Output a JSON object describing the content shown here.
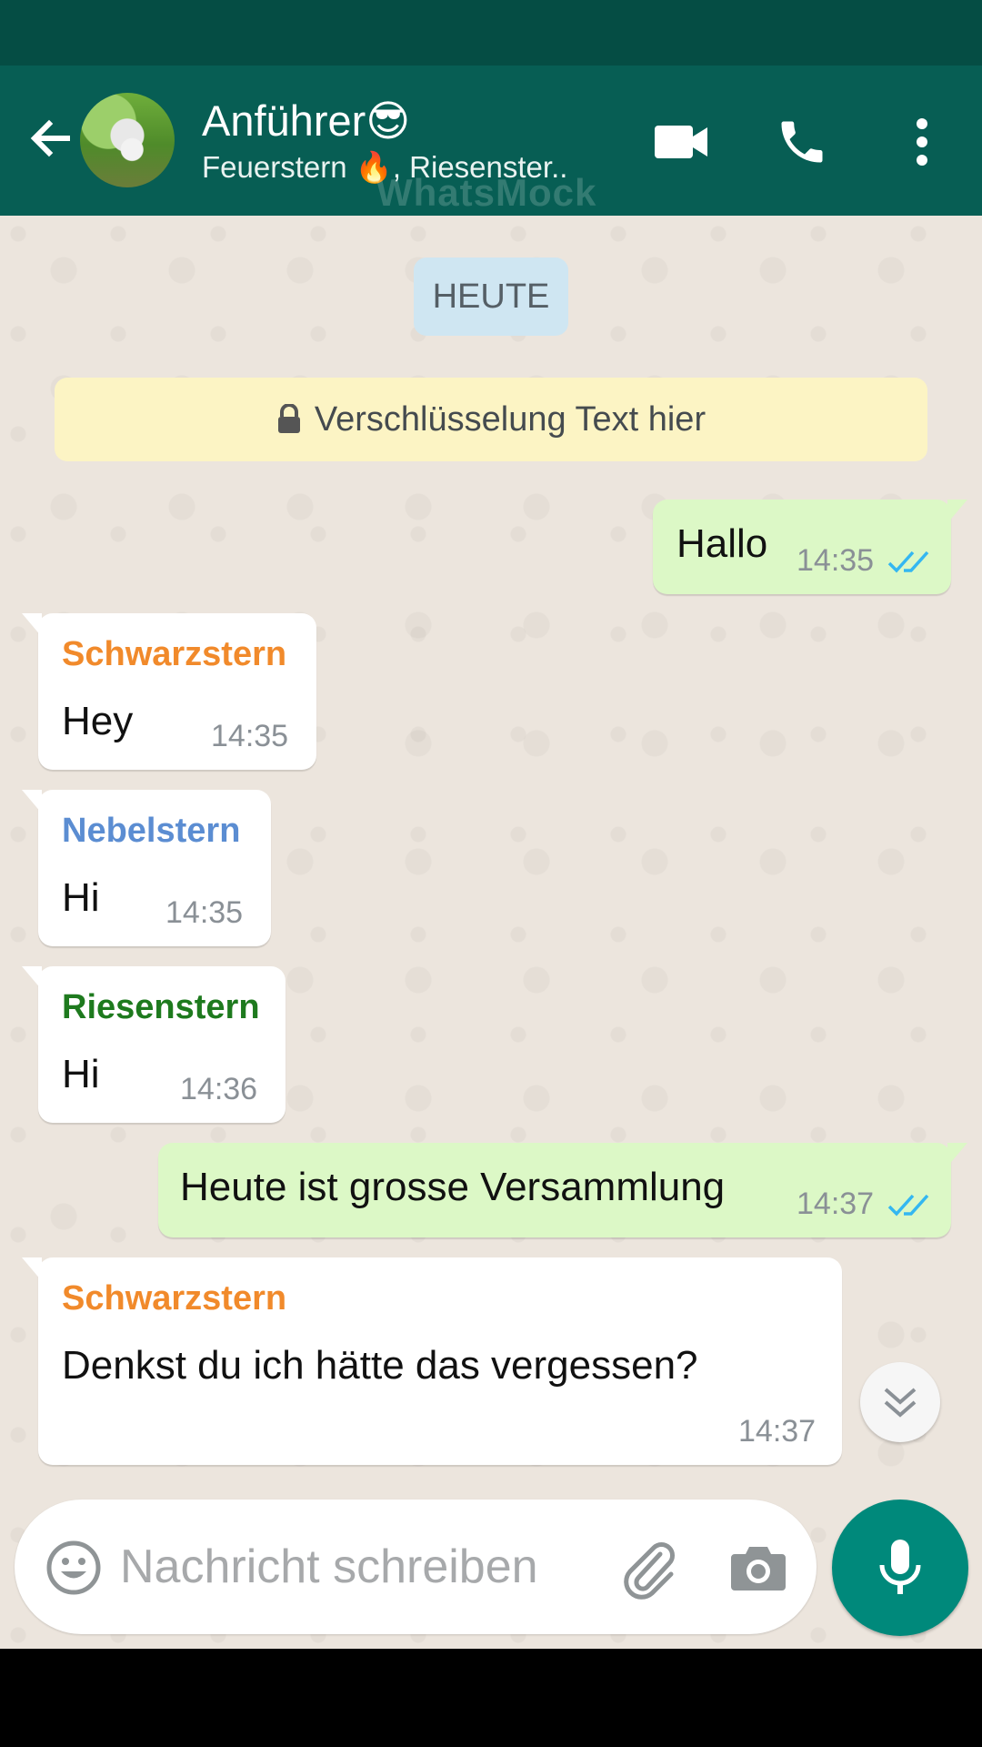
{
  "header": {
    "title": "Anführer😎",
    "subtitle": "Feuerstern 🔥, Riesenster..",
    "watermark": "WhatsMock",
    "video_call_icon": "video-camera-icon",
    "voice_call_icon": "phone-icon",
    "menu_icon": "more-vert-icon",
    "back_icon": "arrow-left-icon"
  },
  "chat": {
    "date_chip": "HEUTE",
    "encryption_notice": "Verschlüsselung Text hier",
    "messages": [
      {
        "direction": "out",
        "text": "Hallo",
        "time": "14:35",
        "status": "read"
      },
      {
        "direction": "in",
        "sender": "Schwarzstern",
        "sender_color": "#f18a2b",
        "text": "Hey",
        "time": "14:35"
      },
      {
        "direction": "in",
        "sender": "Nebelstern",
        "sender_color": "#5b8dd2",
        "text": "Hi",
        "time": "14:35"
      },
      {
        "direction": "in",
        "sender": "Riesenstern",
        "sender_color": "#1e7a1e",
        "text": "Hi",
        "time": "14:36"
      },
      {
        "direction": "out",
        "text": "Heute ist grosse Versammlung",
        "time": "14:37",
        "status": "read"
      },
      {
        "direction": "in",
        "sender": "Schwarzstern",
        "sender_color": "#f18a2b",
        "text": "Denkst du ich hätte das vergessen?",
        "time": "14:37"
      }
    ]
  },
  "composer": {
    "placeholder": "Nachricht schreiben",
    "emoji_icon": "emoji-icon",
    "attach_icon": "paperclip-icon",
    "camera_icon": "camera-icon",
    "mic_icon": "microphone-icon"
  },
  "colors": {
    "appbar": "#075e54",
    "statusbar": "#054d44",
    "outgoing_bubble": "#dcf8c6",
    "chat_background": "#ece5dd",
    "read_ticks": "#34b7f1",
    "mic_button": "#00897b"
  }
}
